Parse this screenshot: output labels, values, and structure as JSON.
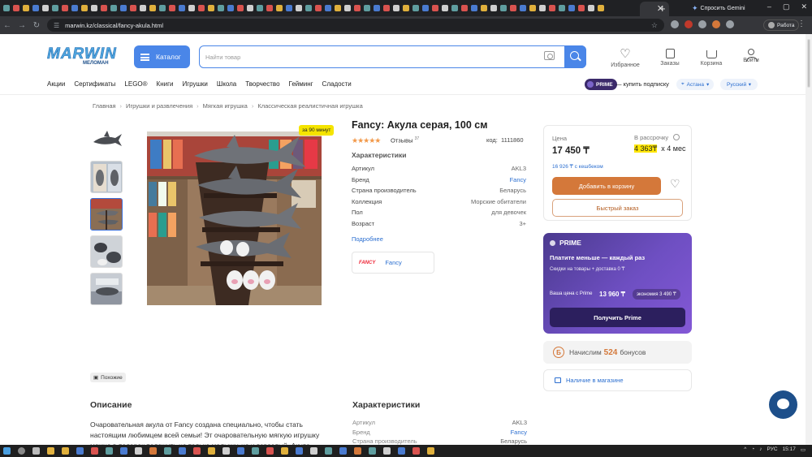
{
  "browser": {
    "active_tab_close": "✕",
    "new_tab": "+",
    "gemini_label": "Спросить Gemini",
    "url": "marwin.kz/classical/fancy-akula.html",
    "profile_label": "Работа"
  },
  "header": {
    "logo_text": "MARWIN",
    "logo_sub": "МЕЛОМАН",
    "catalog_label": "Каталог",
    "search_placeholder": "Найти товар",
    "favorites_label": "Избранное",
    "orders_label": "Заказы",
    "cart_label": "Корзина",
    "login_label": "Войти"
  },
  "nav": {
    "items": [
      "Акции",
      "Сертификаты",
      "LEGO®",
      "Книги",
      "Игрушки",
      "Школа",
      "Творчество",
      "Гейминг",
      "Сладости"
    ],
    "prime_badge": "PRIME",
    "prime_subscribe": "— купить подписку",
    "city": "Астана",
    "language": "Русский"
  },
  "breadcrumbs": [
    "Главная",
    "Игрушки и развлечения",
    "Мягкая игрушка",
    "Классическая реалистичная игрушка"
  ],
  "gallery": {
    "badge": "за 90 минут",
    "similar_label": "Похожие"
  },
  "product": {
    "title": "Fancy: Акула серая, 100 см",
    "rating_stars": "★★★★★",
    "reviews_label": "Отзывы",
    "reviews_count": "37",
    "code_label": "код:",
    "code_value": "1111860",
    "characteristics_heading": "Характеристики",
    "characteristics": [
      {
        "key": "Артикул",
        "value": "AKL3"
      },
      {
        "key": "Бренд",
        "value": "Fancy"
      },
      {
        "key": "Страна производитель",
        "value": "Беларусь"
      },
      {
        "key": "Коллекция",
        "value": "Морские обитатели"
      },
      {
        "key": "Пол",
        "value": "для девочек"
      },
      {
        "key": "Возраст",
        "value": "3+"
      }
    ],
    "more_link": "Подробнее",
    "brand_logo_text": "FANCY",
    "brand_name": "Fancy"
  },
  "price": {
    "label": "Цена",
    "value": "17 450 ₸",
    "installment_label": "В рассрочку",
    "installment_value": "4 363₸",
    "installment_term": "х 4 мес",
    "cashback": "16 926 ₸ с кешбеком",
    "add_to_cart": "Добавить в корзину",
    "quick_order": "Быстрый заказ"
  },
  "prime": {
    "title": "PRIME",
    "headline": "Платите меньше — каждый раз",
    "subline": "Скидки на товары + доставка 0 ₸",
    "your_price_label": "Ваша цена с Prime",
    "your_price_value": "13 960 ₸",
    "economy": "экономия 3 490 ₸",
    "cta": "Получить Prime"
  },
  "bonus": {
    "prefix": "Начислим",
    "amount": "524",
    "suffix": "бонусов",
    "coin": "Б"
  },
  "availability_link": "Наличие в магазине",
  "description": {
    "heading": "Описание",
    "text": "Очаровательная акула от Fancy создана специально, чтобы стать настоящим любимцем всей семьи! Эт очаровательную мягкую игрушку можно в подарок положить не только малышу, но и взрослый. Акула"
  },
  "characteristics_section": {
    "heading": "Характеристики",
    "rows": [
      {
        "key": "Артикул",
        "value": "AKL3"
      },
      {
        "key": "Бренд",
        "value": "Fancy"
      },
      {
        "key": "Страна производитель",
        "value": "Беларусь"
      }
    ]
  },
  "taskbar": {
    "lang": "РУС",
    "time": "15:17"
  },
  "colors": {
    "accent_blue": "#4a86e8",
    "cart_orange": "#d4783a",
    "prime_purple": "#6e4fc2",
    "installment_highlight": "#ffe600"
  }
}
